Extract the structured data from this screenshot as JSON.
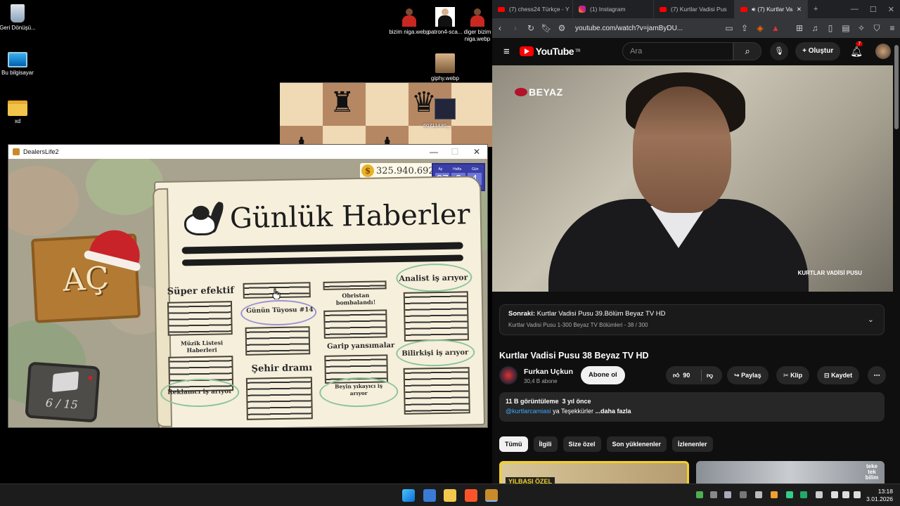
{
  "desktop": {
    "icons": [
      {
        "label": "Geri Dönüşü...",
        "icon": "recycle-bin-icon"
      },
      {
        "label": "Bu bilgisayar",
        "icon": "this-pc-icon"
      },
      {
        "label": "xd",
        "icon": "folder-icon"
      },
      {
        "label": "bizim niga.webp",
        "icon": "image-file-icon"
      },
      {
        "label": "patron4-sca...",
        "icon": "image-file-icon"
      },
      {
        "label": "diger bizim niga.webp",
        "icon": "image-file-icon"
      },
      {
        "label": "giphy.webp",
        "icon": "image-file-icon"
      },
      {
        "label": "60711430_...",
        "icon": "image-file-icon"
      }
    ]
  },
  "game": {
    "window_title": "DealersLife2",
    "money": "325.940.692",
    "calendar_labels": [
      "Ay",
      "Hafta",
      "Gün"
    ],
    "calendar_values": [
      "97",
      "3",
      "4"
    ],
    "open_sign": "AÇ",
    "inventory_count": "6 / 15",
    "newspaper": {
      "title": "Günlük Haberler",
      "headlines": [
        "Süper efektif",
        "Obristan bombalandı!",
        "Analist iş arıyor",
        "Günün Tüyosu #14",
        "Müzik Listesi Haberleri",
        "Garip yansımalar",
        "Bilirkişi iş arıyor",
        "Şehir dramı",
        "Reklamcı iş arıyor",
        "Beyin yıkayıcı iş arıyor"
      ]
    }
  },
  "browser": {
    "tabs": [
      {
        "label": "(7) chess24 Türkçe - Y",
        "fav": "youtube"
      },
      {
        "label": "(1) Instagram",
        "fav": "instagram"
      },
      {
        "label": "(7) Kurtlar Vadisi Pus",
        "fav": "youtube"
      },
      {
        "label": "(7) Kurtlar Va",
        "fav": "youtube",
        "active": true
      }
    ],
    "url": "youtube.com/watch?v=jamByDU...",
    "youtube": {
      "logo": "YouTube",
      "region": "TR",
      "search_placeholder": "Ara",
      "create_label": "Oluştur",
      "notif_count": "7",
      "channel_watermark": "BEYAZ",
      "video_watermark": "KURTLAR VADİSİ PUSU",
      "next_label": "Sonraki:",
      "next_title": "Kurtlar Vadisi Pusu 39.Bölüm Beyaz TV HD",
      "playlist_info": "Kurtlar Vadisi Pusu 1-300 Beyaz TV Bölümleri - 38 / 300",
      "video_title": "Kurtlar Vadisi Pusu 38 Beyaz TV HD",
      "channel_name": "Furkan Uçkun",
      "subscribers": "30,4 B abone",
      "subscribe_label": "Abone ol",
      "likes": "90",
      "share_label": "Paylaş",
      "clip_label": "Klip",
      "save_label": "Kaydet",
      "views": "11 B görüntüleme",
      "uploaded": "3 yıl önce",
      "mention": "@kurtlarcamiasi",
      "desc_rest": " ya Teşekkürler",
      "more_label": "...daha fazla",
      "chips": [
        "Tümü",
        "İlgili",
        "Size özel",
        "Son yüklenenler",
        "İzlenenler"
      ],
      "thumb1_text": "YILBAŞI ÖZEL",
      "thumb2_text": "teke tek bilim"
    }
  },
  "taskbar": {
    "time": "13:18",
    "date": "3.01.2026"
  },
  "colors": {
    "yt_red": "#ff0000",
    "link_blue": "#3ea6ff",
    "calendar_blue": "#3a3fa8",
    "highlight_green": "#8ac59a",
    "highlight_purple": "#9a93d6"
  }
}
